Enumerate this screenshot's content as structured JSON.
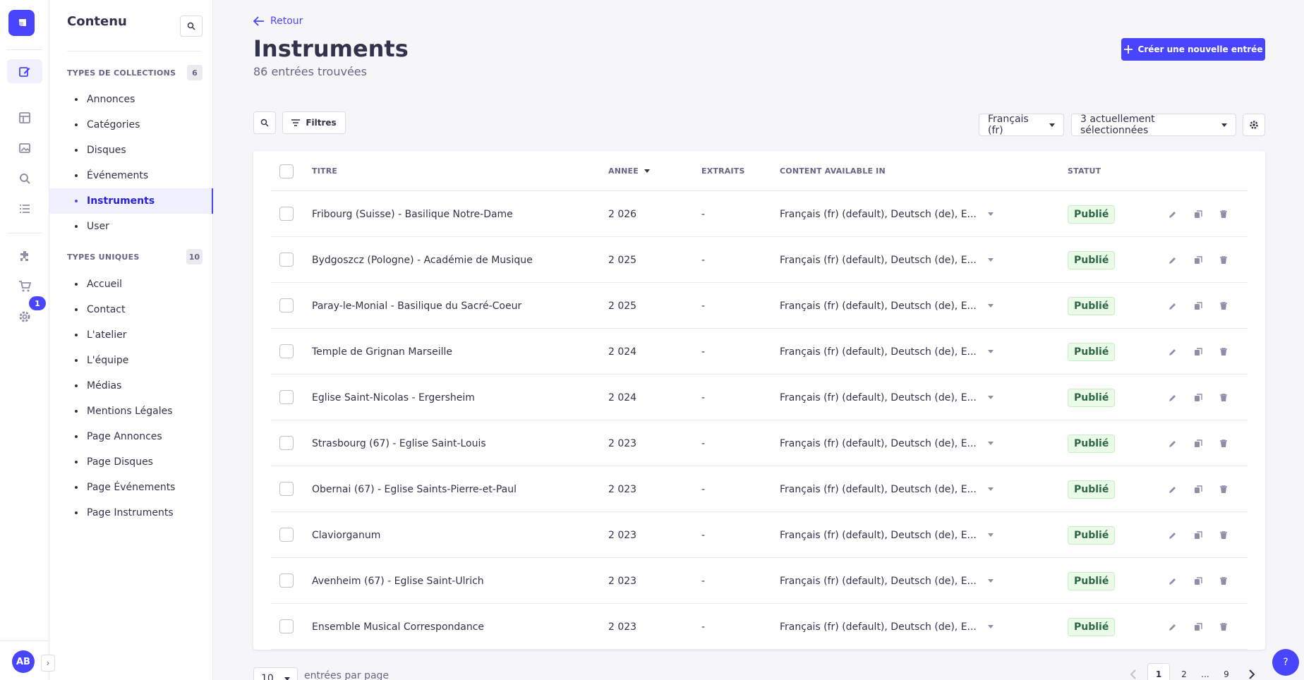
{
  "nav": {
    "notification_count": "1",
    "avatar_initials": "AB"
  },
  "subnav": {
    "title": "Contenu",
    "collections": {
      "label": "TYPES DE COLLECTIONS",
      "count": "6",
      "items": [
        "Annonces",
        "Catégories",
        "Disques",
        "Événements",
        "Instruments",
        "User"
      ]
    },
    "singles": {
      "label": "TYPES UNIQUES",
      "count": "10",
      "items": [
        "Accueil",
        "Contact",
        "L'atelier",
        "L'équipe",
        "Médias",
        "Mentions Légales",
        "Page Annonces",
        "Page Disques",
        "Page Événements",
        "Page Instruments"
      ]
    }
  },
  "header": {
    "back_label": "Retour",
    "title": "Instruments",
    "subtitle": "86 entrées trouvées",
    "create_label": "Créer une nouvelle entrée"
  },
  "toolbar": {
    "filters_label": "Filtres",
    "locale_value": "Français (fr)",
    "columns_value": "3 actuellement sélectionnées"
  },
  "table": {
    "columns": {
      "title": "TITRE",
      "year": "ANNEE",
      "excerpts": "EXTRAITS",
      "available": "CONTENT AVAILABLE IN",
      "status": "STATUT"
    },
    "rows": [
      {
        "title": "Fribourg (Suisse) - Basilique Notre-Dame",
        "year": "2 026",
        "excerpts": "-",
        "available": "Français (fr) (default), Deutsch (de), E...",
        "status": "Publié"
      },
      {
        "title": "Bydgoszcz (Pologne) - Académie de Musique",
        "year": "2 025",
        "excerpts": "-",
        "available": "Français (fr) (default), Deutsch (de), E...",
        "status": "Publié"
      },
      {
        "title": "Paray-le-Monial - Basilique du Sacré-Coeur",
        "year": "2 025",
        "excerpts": "-",
        "available": "Français (fr) (default), Deutsch (de), E...",
        "status": "Publié"
      },
      {
        "title": "Temple de Grignan Marseille",
        "year": "2 024",
        "excerpts": "-",
        "available": "Français (fr) (default), Deutsch (de), E...",
        "status": "Publié"
      },
      {
        "title": "Eglise Saint-Nicolas - Ergersheim",
        "year": "2 024",
        "excerpts": "-",
        "available": "Français (fr) (default), Deutsch (de), E...",
        "status": "Publié"
      },
      {
        "title": "Strasbourg (67) - Eglise Saint-Louis",
        "year": "2 023",
        "excerpts": "-",
        "available": "Français (fr) (default), Deutsch (de), E...",
        "status": "Publié"
      },
      {
        "title": "Obernai (67) - Eglise Saints-Pierre-et-Paul",
        "year": "2 023",
        "excerpts": "-",
        "available": "Français (fr) (default), Deutsch (de), E...",
        "status": "Publié"
      },
      {
        "title": "Claviorganum",
        "year": "2 023",
        "excerpts": "-",
        "available": "Français (fr) (default), Deutsch (de), E...",
        "status": "Publié"
      },
      {
        "title": "Avenheim (67) - Eglise Saint-Ulrich",
        "year": "2 023",
        "excerpts": "-",
        "available": "Français (fr) (default), Deutsch (de), E...",
        "status": "Publié"
      },
      {
        "title": "Ensemble Musical Correspondance",
        "year": "2 023",
        "excerpts": "-",
        "available": "Français (fr) (default), Deutsch (de), E...",
        "status": "Publié"
      }
    ]
  },
  "footer": {
    "per_page_value": "10",
    "per_page_label": "entrées par page",
    "pages": [
      "1",
      "2",
      "...",
      "9"
    ],
    "help_label": "?"
  },
  "colors": {
    "accent": "#4945ff",
    "published_bg": "#eafbe7",
    "published_text": "#2f6846"
  }
}
